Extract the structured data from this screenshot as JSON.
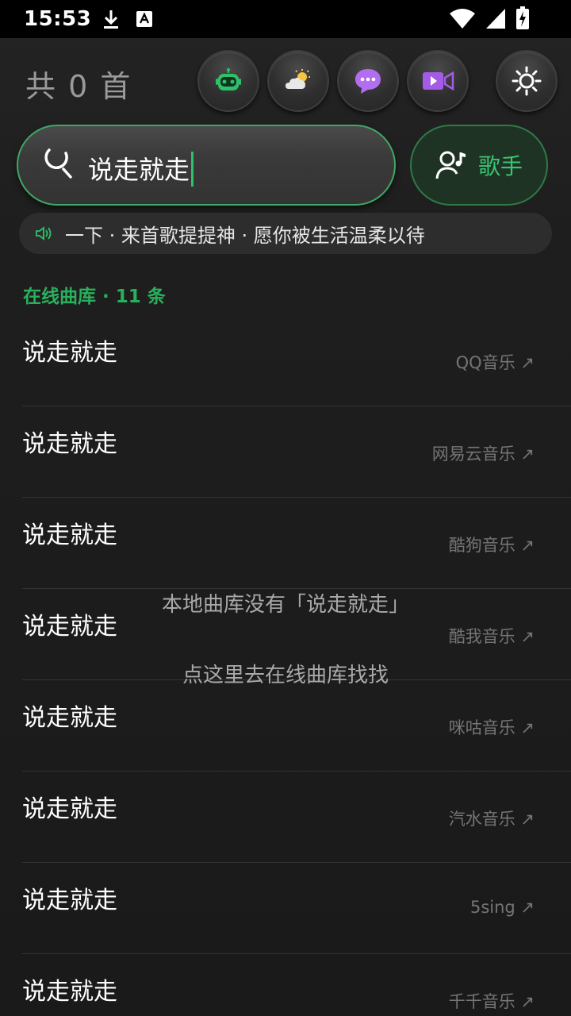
{
  "status_bar": {
    "time": "15:53"
  },
  "header": {
    "song_count": "共 0 首"
  },
  "toolbar": {
    "buttons": [
      {
        "name": "robot",
        "icon": "robot-icon"
      },
      {
        "name": "weather",
        "icon": "weather-icon"
      },
      {
        "name": "chat",
        "icon": "chat-icon"
      },
      {
        "name": "video",
        "icon": "video-icon"
      },
      {
        "name": "settings",
        "icon": "gear-icon"
      }
    ]
  },
  "search": {
    "value": "说走就走"
  },
  "singer_button": {
    "label": "歌手"
  },
  "ticker": {
    "text": "一下 · 来首歌提提神 · 愿你被生活温柔以待"
  },
  "online_section": {
    "title": "在线曲库 · 11 条"
  },
  "results": [
    {
      "title": "说走就走",
      "source": "QQ音乐 ↗"
    },
    {
      "title": "说走就走",
      "source": "网易云音乐 ↗"
    },
    {
      "title": "说走就走",
      "source": "酷狗音乐 ↗"
    },
    {
      "title": "说走就走",
      "source": "酷我音乐 ↗"
    },
    {
      "title": "说走就走",
      "source": "咪咕音乐 ↗"
    },
    {
      "title": "说走就走",
      "source": "汽水音乐 ↗"
    },
    {
      "title": "说走就走",
      "source": "5sing ↗"
    },
    {
      "title": "说走就走",
      "source": "千千音乐 ↗"
    }
  ],
  "local_empty": {
    "message": "本地曲库没有「说走就走」",
    "link": "点这里去在线曲库找找"
  },
  "colors": {
    "accent": "#2fc16a",
    "background": "#1c1c1c",
    "source_text": "#757575"
  }
}
